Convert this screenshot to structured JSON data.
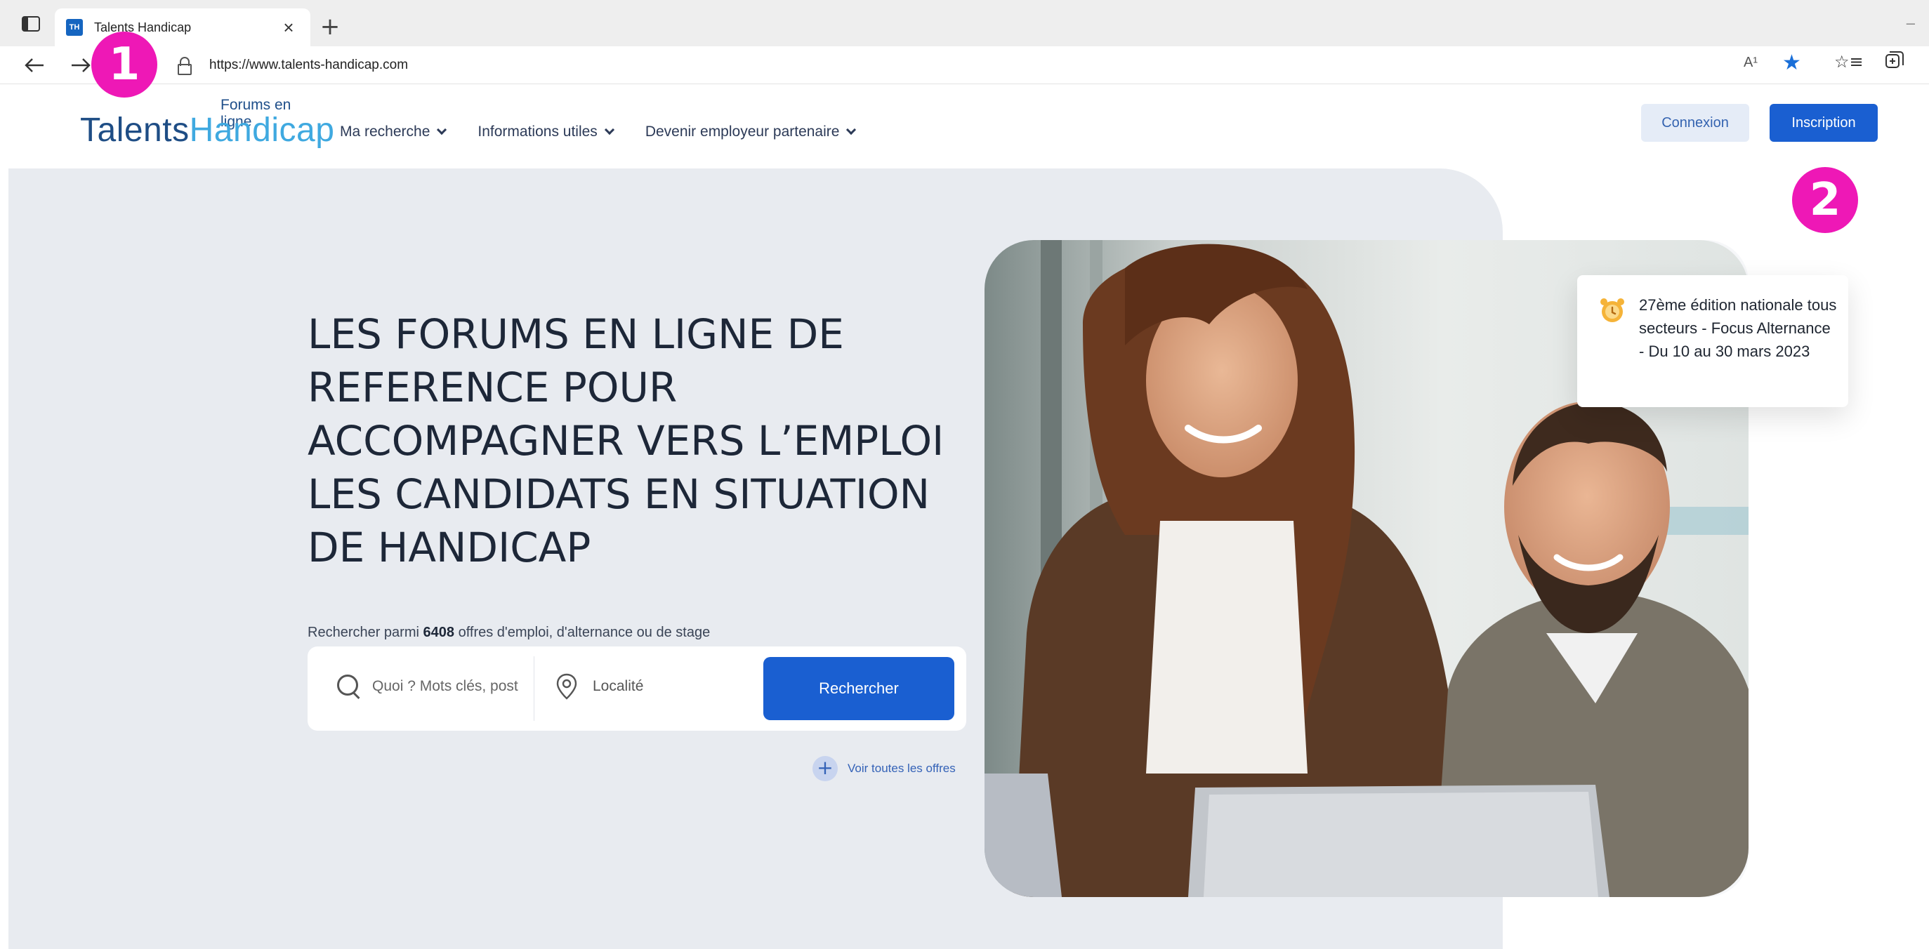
{
  "browser": {
    "tab_title": "Talents Handicap",
    "favicon_text": "TH",
    "url": "https://www.talents-handicap.com",
    "reader_label": "A¹",
    "icons": [
      "sidebar-icon",
      "back-icon",
      "forward-icon",
      "reload-icon",
      "lock-icon",
      "read-aloud-icon",
      "favorite-star-icon",
      "favorites-list-icon",
      "collections-icon"
    ]
  },
  "header": {
    "logo_small": "Forums en ligne",
    "logo_part1": "Talents",
    "logo_part2": "Handicap",
    "nav": [
      {
        "label": "Ma recherche"
      },
      {
        "label": "Informations utiles"
      },
      {
        "label": "Devenir employeur partenaire"
      }
    ],
    "login_label": "Connexion",
    "signup_label": "Inscription"
  },
  "hero": {
    "title": "LES FORUMS EN LIGNE DE REFERENCE POUR ACCOMPAGNER VERS L’EMPLOI LES CANDIDATS EN SITUATION DE HANDICAP",
    "caption_before": "Rechercher parmi ",
    "caption_count": "6408",
    "caption_after": " offres d'emploi, d'alternance ou de stage",
    "search_placeholder": "Quoi ? Mots clés, post",
    "location_placeholder": "Localité",
    "search_button": "Rechercher",
    "see_all": "Voir toutes les offres"
  },
  "event": {
    "text": "27ème édition nationale tous secteurs - Focus Alternance - Du 10 au 30 mars 2023"
  },
  "annotations": {
    "badge1": "1",
    "badge2": "2"
  },
  "colors": {
    "accent": "#1a5fd1",
    "badge": "#ee18b6",
    "logo_dark": "#1e4d85",
    "logo_light": "#3fa9e0",
    "hero_bg": "#e8ebf0"
  }
}
